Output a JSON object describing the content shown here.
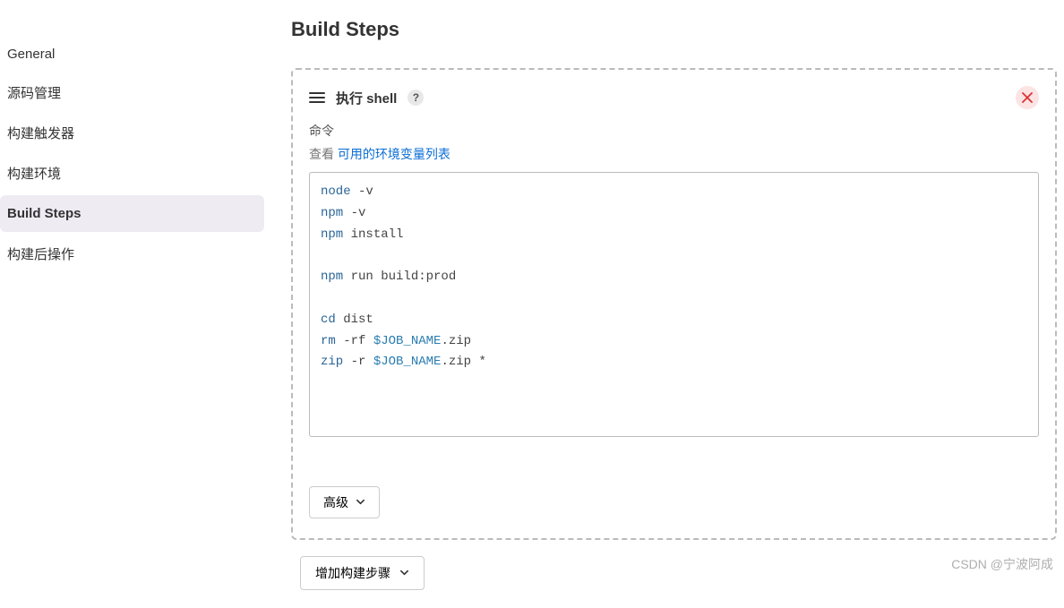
{
  "sidebar": {
    "items": [
      {
        "label": "General",
        "active": false
      },
      {
        "label": "源码管理",
        "active": false
      },
      {
        "label": "构建触发器",
        "active": false
      },
      {
        "label": "构建环境",
        "active": false
      },
      {
        "label": "Build Steps",
        "active": true
      },
      {
        "label": "构建后操作",
        "active": false
      }
    ]
  },
  "main": {
    "title": "Build Steps",
    "step": {
      "title": "执行 shell",
      "help_icon": "?",
      "command_label": "命令",
      "help_prefix": "查看 ",
      "help_link": "可用的环境变量列表",
      "code_lines": [
        [
          {
            "t": "cmd",
            "v": "node"
          },
          {
            "t": "txt",
            "v": " -v"
          }
        ],
        [
          {
            "t": "cmd",
            "v": "npm"
          },
          {
            "t": "txt",
            "v": " -v"
          }
        ],
        [
          {
            "t": "cmd",
            "v": "npm"
          },
          {
            "t": "txt",
            "v": " install"
          }
        ],
        [],
        [
          {
            "t": "cmd",
            "v": "npm"
          },
          {
            "t": "txt",
            "v": " run build:prod"
          }
        ],
        [],
        [
          {
            "t": "cmd",
            "v": "cd"
          },
          {
            "t": "txt",
            "v": " dist"
          }
        ],
        [
          {
            "t": "cmd",
            "v": "rm"
          },
          {
            "t": "txt",
            "v": " -rf "
          },
          {
            "t": "var",
            "v": "$JOB_NAME"
          },
          {
            "t": "txt",
            "v": ".zip"
          }
        ],
        [
          {
            "t": "cmd",
            "v": "zip"
          },
          {
            "t": "txt",
            "v": " -r "
          },
          {
            "t": "var",
            "v": "$JOB_NAME"
          },
          {
            "t": "txt",
            "v": ".zip *"
          }
        ]
      ],
      "advanced_label": "高级"
    },
    "add_step_label": "增加构建步骤"
  },
  "watermark": "CSDN @宁波阿成"
}
